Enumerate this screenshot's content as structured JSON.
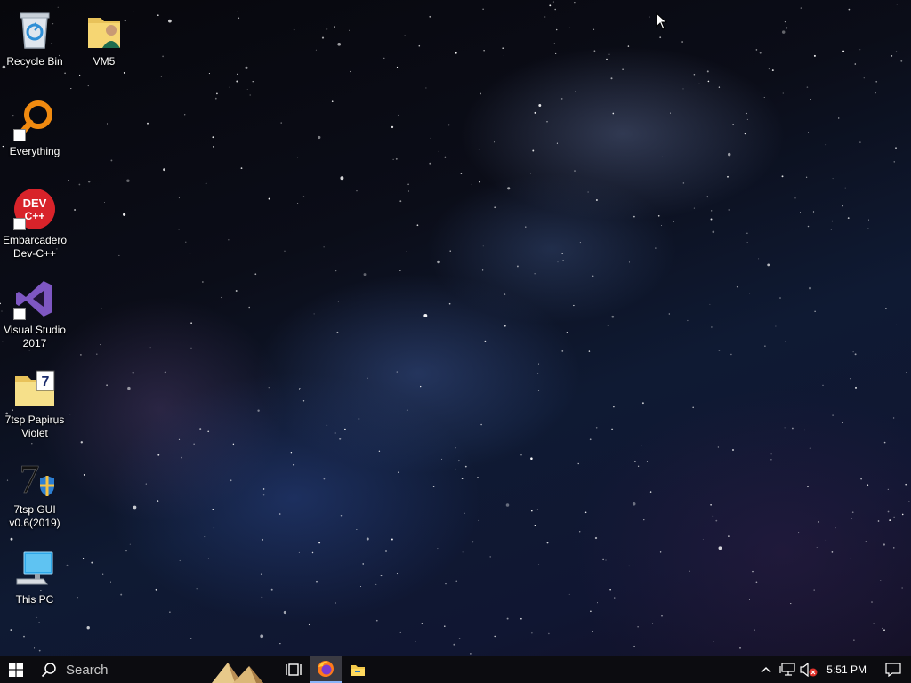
{
  "desktop": {
    "icons": [
      {
        "label": "Recycle Bin",
        "icon": "recycle-bin-icon"
      },
      {
        "label": "VM5",
        "icon": "user-folder-icon"
      },
      {
        "label": "Everything",
        "icon": "everything-search-icon"
      },
      {
        "label": "Embarcadero Dev-C++",
        "icon": "devcpp-icon",
        "glyph_text": "DEV C++"
      },
      {
        "label": "Visual Studio 2017",
        "icon": "visual-studio-icon"
      },
      {
        "label": "7tsp Papirus Violet",
        "icon": "7tsp-folder-icon",
        "glyph_text": "7"
      },
      {
        "label": "7tsp GUI v0.6(2019)",
        "icon": "7tsp-gui-icon",
        "glyph_text": "7"
      },
      {
        "label": "This PC",
        "icon": "this-pc-icon"
      }
    ]
  },
  "taskbar": {
    "search_placeholder": "Search",
    "pinned": [
      {
        "name": "task-view",
        "icon": "task-view-icon"
      },
      {
        "name": "firefox",
        "icon": "firefox-icon",
        "active": true
      },
      {
        "name": "file-explorer",
        "icon": "file-explorer-icon"
      }
    ],
    "tray": {
      "time": "5:51 PM",
      "icons": [
        "show-hidden-icons-icon",
        "network-icon",
        "volume-muted-icon",
        "action-center-icon"
      ]
    }
  },
  "colors": {
    "taskbar": "#0c0c10",
    "accent": "#8ab4f8"
  }
}
